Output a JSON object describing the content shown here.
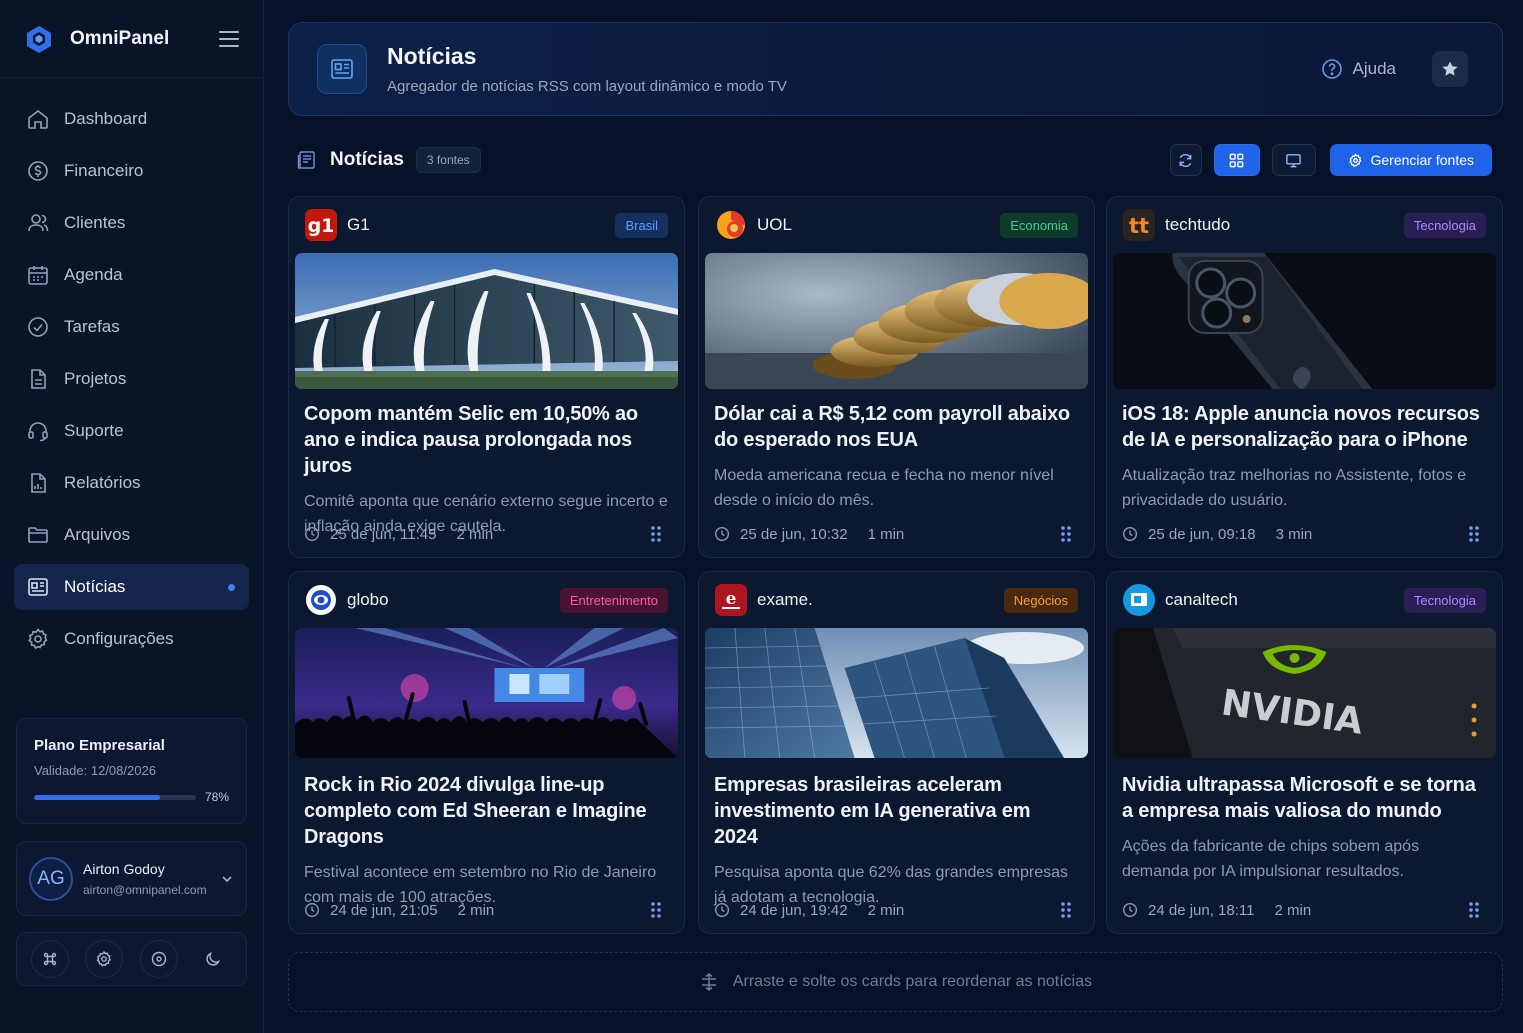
{
  "app": {
    "name": "OmniPanel"
  },
  "sidebar": {
    "items": [
      {
        "label": "Dashboard",
        "icon": "home-icon"
      },
      {
        "label": "Financeiro",
        "icon": "coin-icon"
      },
      {
        "label": "Clientes",
        "icon": "users-icon"
      },
      {
        "label": "Agenda",
        "icon": "calendar-icon"
      },
      {
        "label": "Tarefas",
        "icon": "check-circle-icon"
      },
      {
        "label": "Projetos",
        "icon": "file-icon"
      },
      {
        "label": "Suporte",
        "icon": "headset-icon"
      },
      {
        "label": "Relatórios",
        "icon": "report-icon"
      },
      {
        "label": "Arquivos",
        "icon": "folder-icon"
      },
      {
        "label": "Notícias",
        "icon": "newspaper-icon",
        "active": true
      },
      {
        "label": "Configurações",
        "icon": "gear-icon"
      }
    ],
    "plan": {
      "title": "Plano Empresarial",
      "validity": "Validade: 12/08/2026",
      "progress": 0.78,
      "progress_label": "78%"
    },
    "user": {
      "initials": "AG",
      "name": "Airton Godoy",
      "email": "airton@omnipanel.com"
    }
  },
  "header": {
    "title": "Notícias",
    "subtitle": "Agregador de notícias RSS com layout dinâmico e modo TV",
    "help_label": "Ajuda"
  },
  "toolbar": {
    "title": "Notícias",
    "badge": "3 fontes",
    "manage_label": "Gerenciar fontes"
  },
  "news": [
    {
      "source": "G1",
      "category": "Brasil",
      "title": "Copom mantém Selic em 10,50% ao ano e indica pausa prolongada nos juros",
      "description": "Comitê aponta que cenário externo segue incerto e inflação ainda exige cautela.",
      "date": "25 de jun, 11:45",
      "duration": "2 min"
    },
    {
      "source": "UOL",
      "category": "Economia",
      "title": "Dólar cai a R$ 5,12 com payroll abaixo do esperado nos EUA",
      "description": "Moeda americana recua e fecha no menor nível desde o início do mês.",
      "date": "25 de jun, 10:32",
      "duration": "1 min"
    },
    {
      "source": "techtudo",
      "category": "Tecnologia",
      "title": "iOS 18: Apple anuncia novos recursos de IA e personalização para o iPhone",
      "description": "Atualização traz melhorias no Assistente, fotos e privacidade do usuário.",
      "date": "25 de jun, 09:18",
      "duration": "3 min"
    },
    {
      "source": "globo",
      "category": "Entretenimento",
      "title": "Rock in Rio 2024 divulga line-up completo com Ed Sheeran e Imagine Dragons",
      "description": "Festival acontece em setembro no Rio de Janeiro com mais de 100 atrações.",
      "date": "24 de jun, 21:05",
      "duration": "2 min"
    },
    {
      "source": "exame.",
      "category": "Negócios",
      "title": "Empresas brasileiras aceleram investimento em IA generativa em 2024",
      "description": "Pesquisa aponta que 62% das grandes empresas já adotam a tecnologia.",
      "date": "24 de jun, 19:42",
      "duration": "2 min"
    },
    {
      "source": "canaltech",
      "category": "Tecnologia",
      "title": "Nvidia ultrapassa Microsoft e se torna a empresa mais valiosa do mundo",
      "description": "Ações da fabricante de chips sobem após demanda por IA impulsionar resultados.",
      "date": "24 de jun, 18:11",
      "duration": "2 min"
    }
  ],
  "dropzone": {
    "label": "Arraste e solte os cards para reordenar as notícias"
  },
  "colors": {
    "accent": "#1f63e8",
    "background": "#071127",
    "card": "#0c1730"
  }
}
